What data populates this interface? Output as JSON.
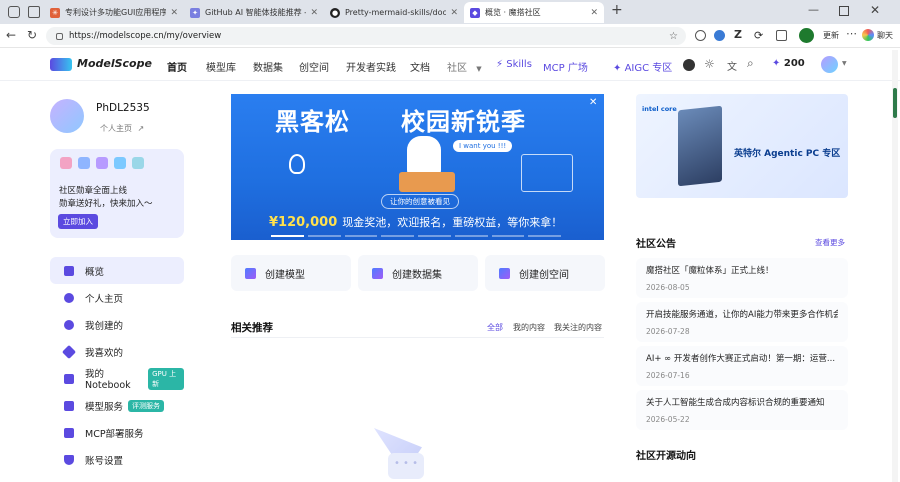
{
  "browser": {
    "tabs": [
      {
        "title": "专利设计多功能GUI应用程序设计"
      },
      {
        "title": "GitHub AI 智能体技能推荐 - Goog"
      },
      {
        "title": "Pretty-mermaid-skills/docs/THEM"
      },
      {
        "title": "概览 · 魔搭社区"
      }
    ],
    "url": "https://modelscope.cn/my/overview",
    "update_label": "更新",
    "chat_label": "聊天"
  },
  "site": {
    "logo": "ModelScope",
    "nav": [
      "首页",
      "模型库",
      "数据集",
      "创空间",
      "开发者实践",
      "文档",
      "社区",
      "Skills",
      "MCP 广场",
      "AIGC 专区"
    ],
    "points": "200"
  },
  "user": {
    "name": "PhDL2535",
    "profile_link": "个人主页",
    "medal_line1": "社区勋章全面上线",
    "medal_line2": "勋章送好礼，快来加入～",
    "join_button": "立即加入"
  },
  "sidebar": {
    "items": [
      {
        "label": "概览"
      },
      {
        "label": "个人主页"
      },
      {
        "label": "我创建的"
      },
      {
        "label": "我喜欢的"
      },
      {
        "label": "我的Notebook",
        "badge": "GPU 上新"
      },
      {
        "label": "模型服务",
        "badge": "评测服务"
      },
      {
        "label": "MCP部署服务"
      },
      {
        "label": "账号设置"
      }
    ]
  },
  "banner": {
    "title_left": "黑客松",
    "title_right": "校园新锐季",
    "bubble": "I want you !!!",
    "sub": "让你的创意被看见",
    "prize": "¥120,000",
    "slogan": "现金奖池，欢迎报名，重磅权益，等你来拿！"
  },
  "actions": [
    "创建模型",
    "创建数据集",
    "创建创空间"
  ],
  "recommend": {
    "title": "相关推荐",
    "tabs": [
      "全部",
      "我的内容",
      "我关注的内容"
    ]
  },
  "ad": {
    "brand": "intel core",
    "title": "英特尔 Agentic PC 专区"
  },
  "announcements": {
    "title": "社区公告",
    "more": "查看更多",
    "items": [
      {
        "title": "魔搭社区「魔粒体系」正式上线！",
        "date": "2026-08-05"
      },
      {
        "title": "开启技能服务通道，让你的AI能力带来更多合作机会",
        "date": "2026-07-28"
      },
      {
        "title": "AI+ ∞ 开发者创作大赛正式启动！第一期：运营...",
        "date": "2026-07-16"
      },
      {
        "title": "关于人工智能生成合成内容标识合规的重要通知",
        "date": "2026-05-22"
      }
    ]
  },
  "trends": {
    "title": "社区开源动向"
  },
  "colors": {
    "brand": "#5b4ae0",
    "banner": "#1f6fe0",
    "teal_badge": "#2bb6a6"
  }
}
